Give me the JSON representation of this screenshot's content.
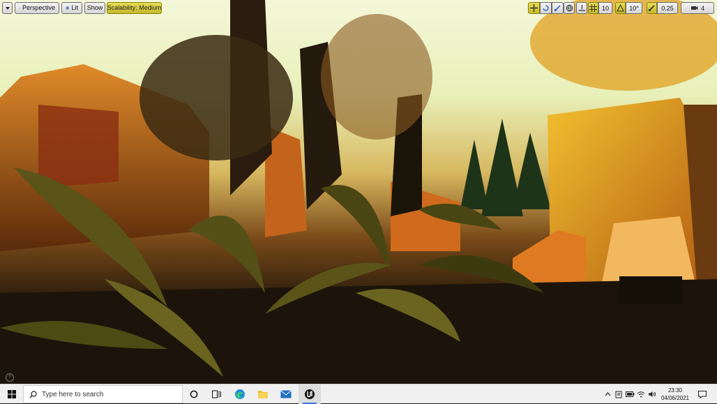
{
  "viewport_toolbar": {
    "perspective_label": "Perspective",
    "lit_label": "Lit",
    "show_label": "Show",
    "scalability_label": "Scalability: Medium",
    "grid_snap_value": "10",
    "rotation_snap_value": "10°",
    "scale_snap_value": "0.25",
    "camera_speed_value": "4"
  },
  "help_icon": "?",
  "taskbar": {
    "search_placeholder": "Type here to search",
    "time": "23:30",
    "date": "04/06/2021"
  },
  "colors": {
    "toolbar_active": "#d9cf3d",
    "taskbar_bg": "#f0f0f0",
    "accent": "#3b78d6"
  }
}
